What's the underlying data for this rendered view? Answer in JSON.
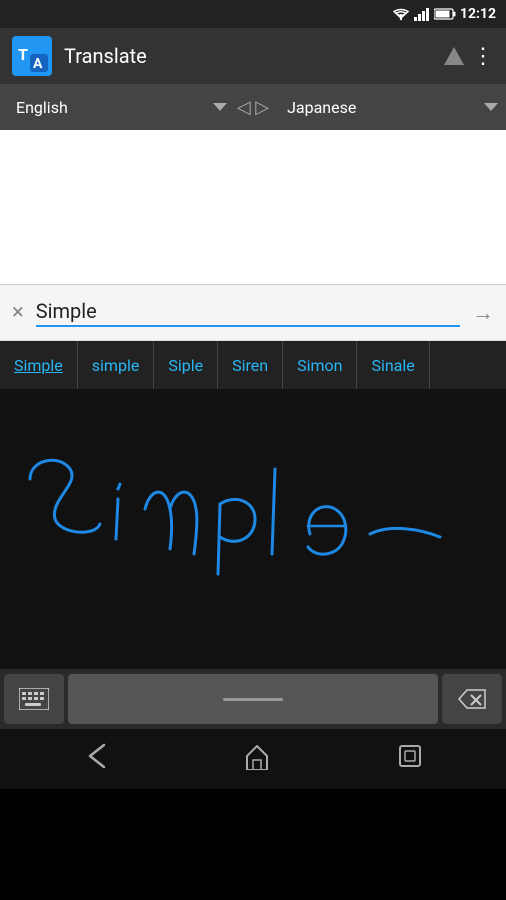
{
  "statusBar": {
    "time": "12:12"
  },
  "appBar": {
    "title": "Translate",
    "iconLabel": "T"
  },
  "languageBar": {
    "sourceLanguage": "English",
    "targetLanguage": "Japanese",
    "swapLabel": "◁ ▷"
  },
  "inputArea": {
    "currentText": "Simple",
    "clearLabel": "×",
    "goLabel": "→"
  },
  "suggestions": [
    {
      "label": "Simple",
      "active": true
    },
    {
      "label": "simple",
      "active": false
    },
    {
      "label": "Siple",
      "active": false
    },
    {
      "label": "Siren",
      "active": false
    },
    {
      "label": "Simon",
      "active": false
    },
    {
      "label": "Sinale",
      "active": false
    }
  ],
  "handwriting": {
    "strokeColor": "#1E88E5"
  },
  "keyboardBar": {
    "keyboardSwitchIcon": "⌨",
    "deleteIcon": "⌫"
  },
  "navBar": {
    "backLabel": "◁",
    "homeLabel": "⌂",
    "recentsLabel": "▣"
  }
}
